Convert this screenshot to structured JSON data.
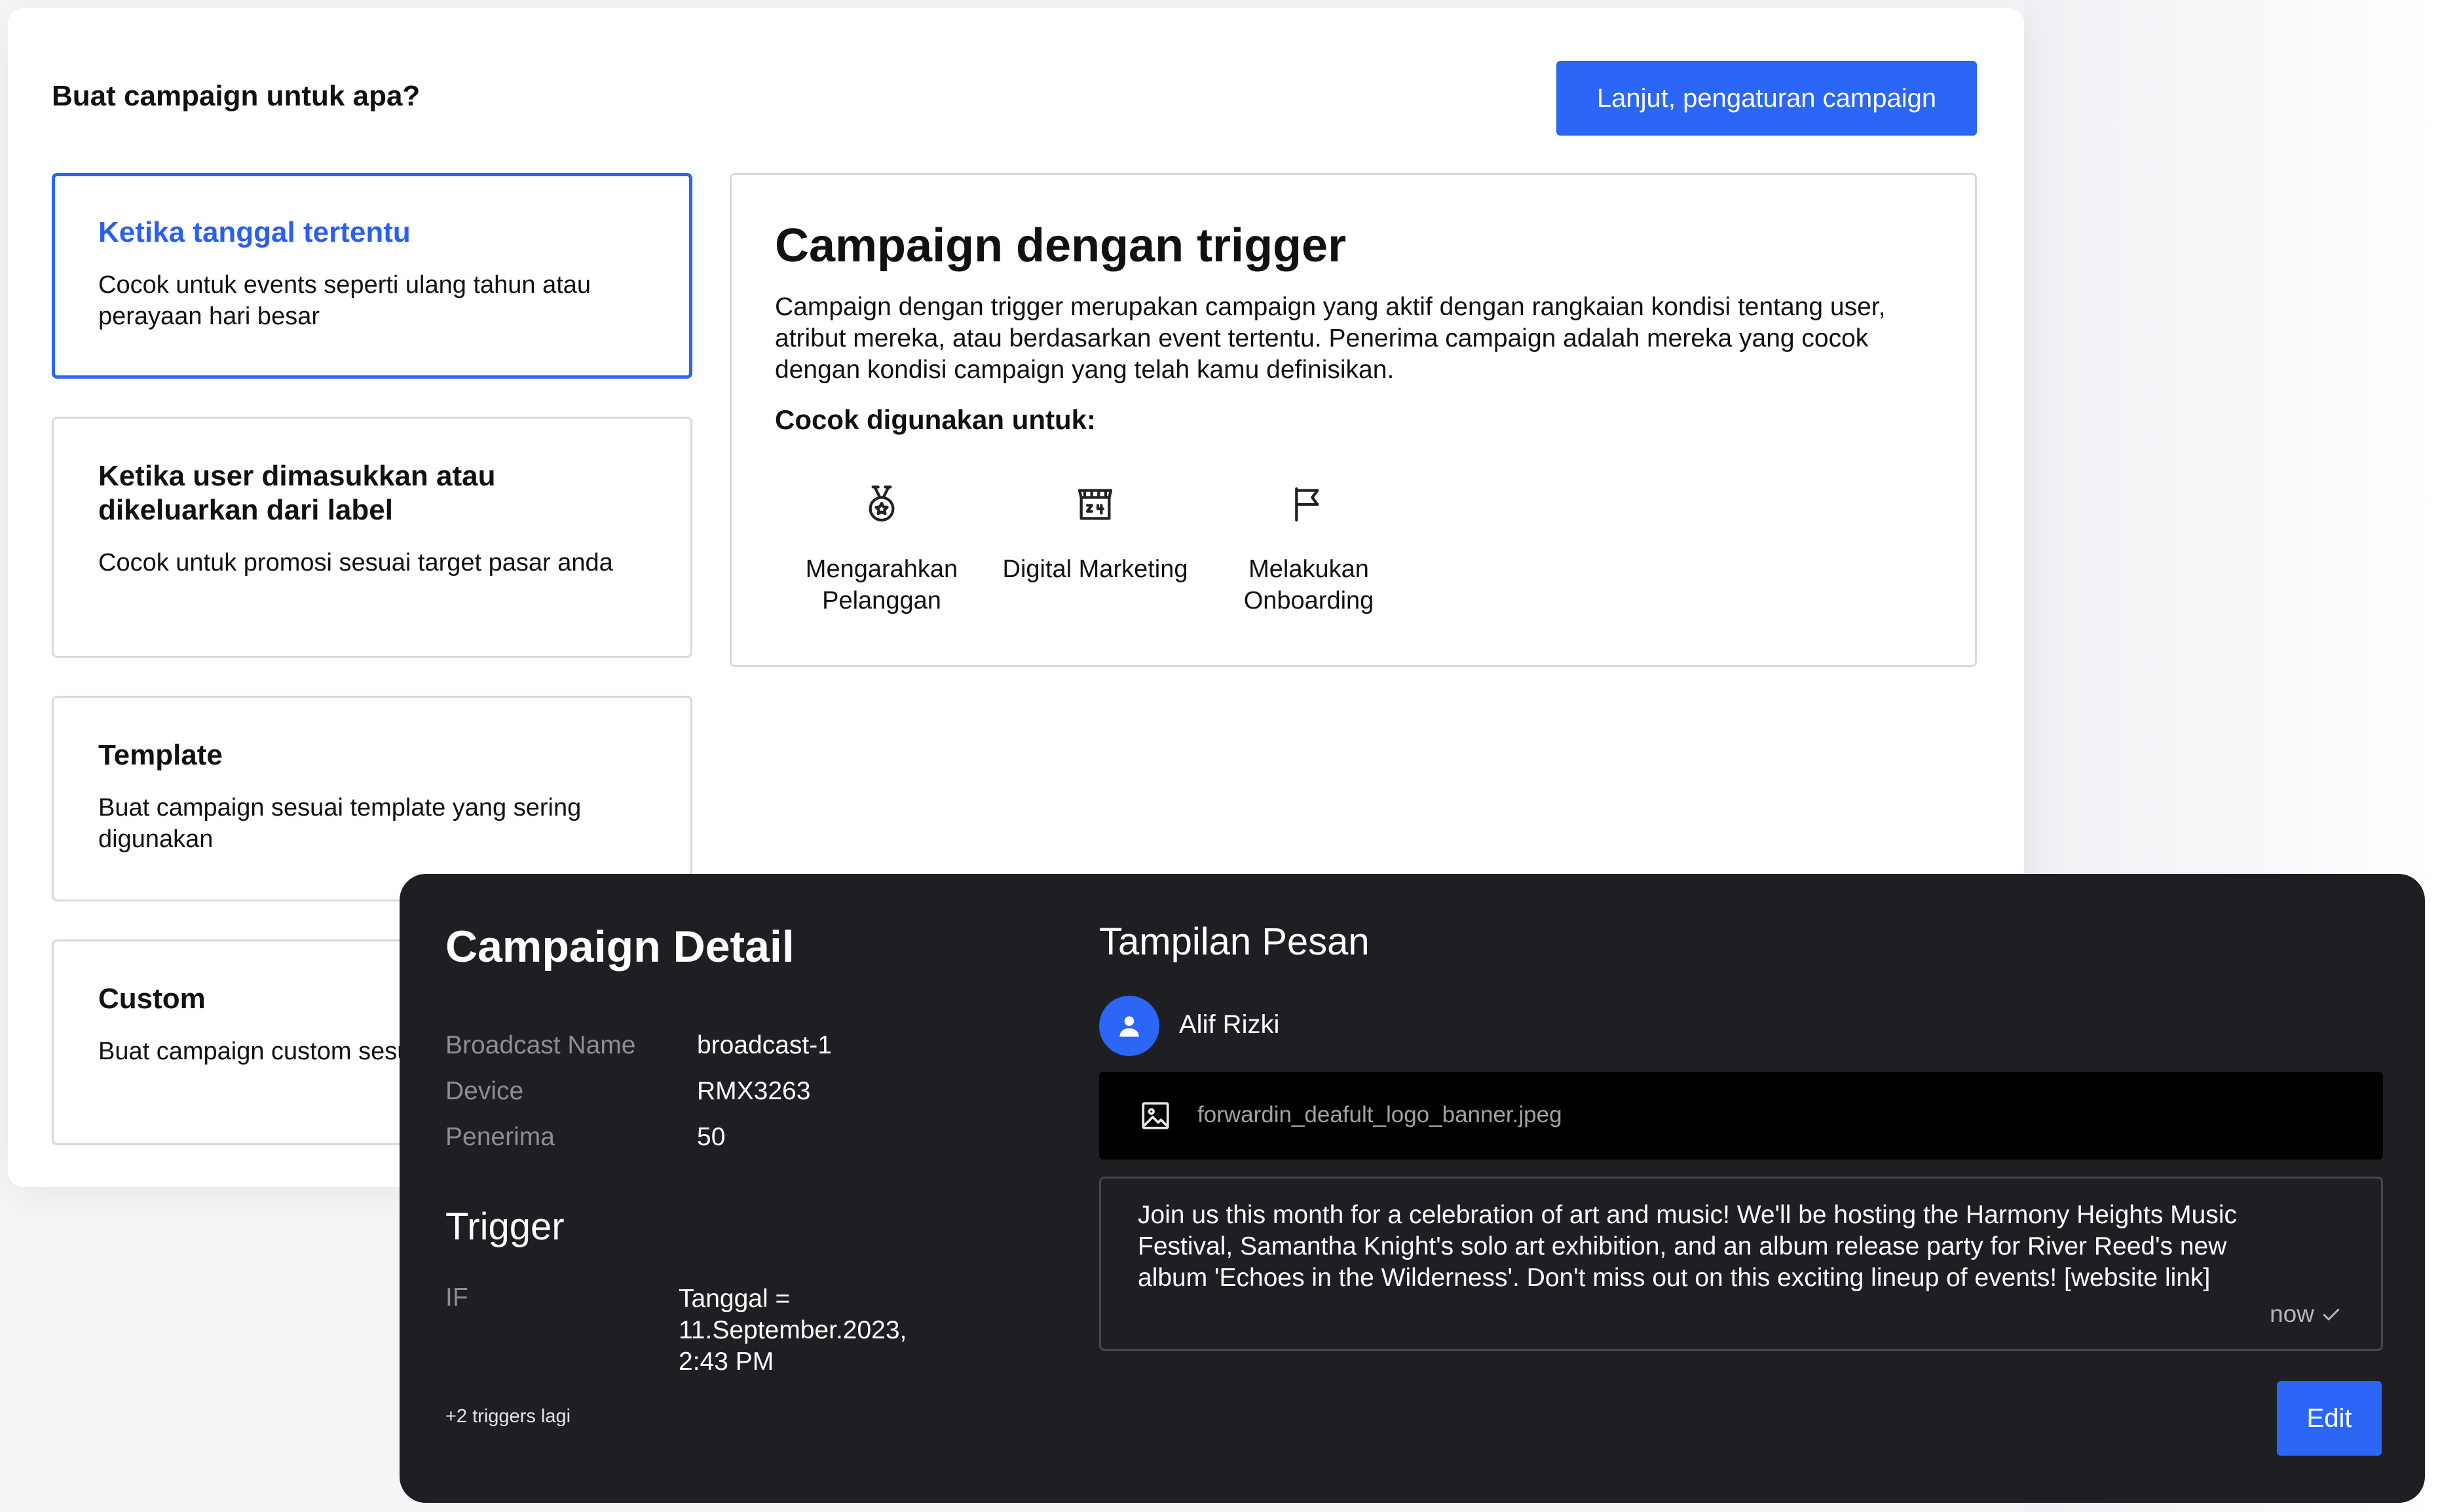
{
  "header": {
    "title": "Buat campaign untuk apa?",
    "next_button": "Lanjut, pengaturan campaign"
  },
  "options": [
    {
      "title": "Ketika tanggal tertentu",
      "desc": "Cocok untuk events seperti ulang tahun atau perayaan hari besar",
      "selected": true
    },
    {
      "title": "Ketika user dimasukkan atau dikeluarkan dari label",
      "desc": "Cocok untuk promosi sesuai target pasar anda",
      "selected": false
    },
    {
      "title": "Template",
      "desc": "Buat campaign sesuai template yang sering digunakan",
      "selected": false
    },
    {
      "title": "Custom",
      "desc": "Buat campaign custom sesuai kebutuhan anda",
      "selected": false
    }
  ],
  "info": {
    "title": "Campaign dengan trigger",
    "desc": "Campaign dengan trigger merupakan campaign yang aktif dengan rangkaian kondisi tentang user, atribut mereka, atau berdasarkan event tertentu. Penerima campaign adalah mereka yang cocok dengan kondisi campaign yang telah kamu definisikan.",
    "uses_title": "Cocok digunakan untuk:",
    "uses": [
      {
        "icon": "medal-icon",
        "label": "Mengarahkan Pelanggan"
      },
      {
        "icon": "store-24-icon",
        "label": "Digital Marketing"
      },
      {
        "icon": "flag-icon",
        "label": "Melakukan Onboarding"
      }
    ]
  },
  "detail": {
    "title": "Campaign Detail",
    "fields": [
      {
        "key": "Broadcast Name",
        "value": "broadcast-1"
      },
      {
        "key": "Device",
        "value": "RMX3263"
      },
      {
        "key": "Penerima",
        "value": "50"
      }
    ],
    "trigger_title": "Trigger",
    "trigger_key": "IF",
    "trigger_value": "Tanggal = 11.September.2023, 2:43 PM",
    "more_triggers": "+2 triggers lagi"
  },
  "preview": {
    "title": "Tampilan Pesan",
    "sender": "Alif Rizki",
    "attachment": "forwardin_deafult_logo_banner.jpeg",
    "message": "Join us this month for a celebration of art and music! We'll be hosting the Harmony Heights Music Festival, Samantha Knight's solo art exhibition, and an album release party for River Reed's new album 'Echoes in the Wilderness'. Don't miss out on this exciting lineup of events! [website link]",
    "time": "now",
    "edit_button": "Edit"
  },
  "colors": {
    "accent": "#2b66f6",
    "dark_panel": "#1e1f22"
  }
}
